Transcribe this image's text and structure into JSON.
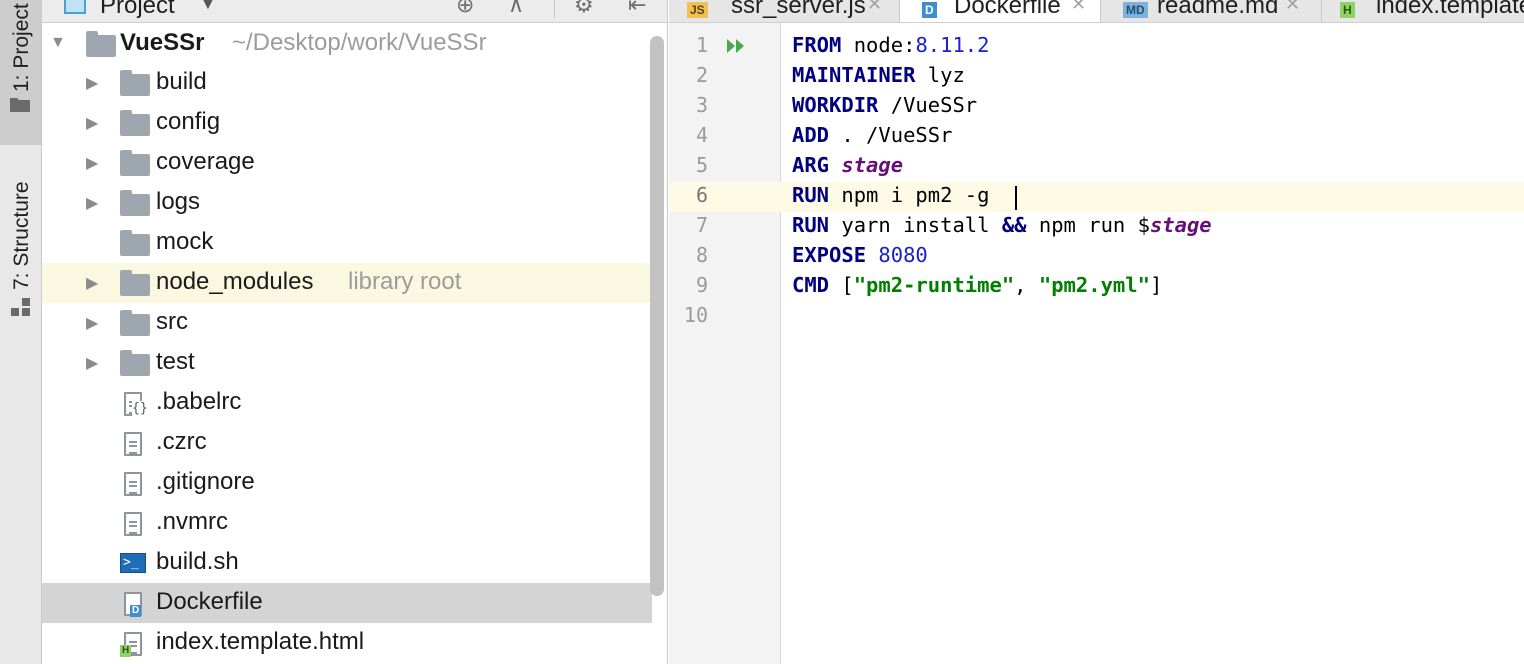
{
  "tool_strip": {
    "project_tab": "1: Project",
    "structure_tab": "7: Structure"
  },
  "project_panel": {
    "title": "Project",
    "root": {
      "name": "VueSSr",
      "path": "~/Desktop/work/VueSSr"
    },
    "items": [
      {
        "label": "build",
        "type": "folder",
        "expandable": true
      },
      {
        "label": "config",
        "type": "folder",
        "expandable": true
      },
      {
        "label": "coverage",
        "type": "folder",
        "expandable": true
      },
      {
        "label": "logs",
        "type": "folder",
        "expandable": true
      },
      {
        "label": "mock",
        "type": "folder",
        "expandable": false
      },
      {
        "label": "node_modules",
        "type": "folder",
        "expandable": true,
        "note": "library root"
      },
      {
        "label": "src",
        "type": "folder",
        "expandable": true
      },
      {
        "label": "test",
        "type": "folder",
        "expandable": true
      },
      {
        "label": ".babelrc",
        "type": "config-file"
      },
      {
        "label": ".czrc",
        "type": "text-file"
      },
      {
        "label": ".gitignore",
        "type": "text-file"
      },
      {
        "label": ".nvmrc",
        "type": "text-file"
      },
      {
        "label": "build.sh",
        "type": "shell-file"
      },
      {
        "label": "Dockerfile",
        "type": "docker-file",
        "selected": true
      },
      {
        "label": "index.template.html",
        "type": "html-file"
      }
    ]
  },
  "tabs": [
    {
      "label": "ssr_server.js",
      "icon": "JS",
      "icon_color": "#f0c050"
    },
    {
      "label": "Dockerfile",
      "icon": "D",
      "icon_color": "#3d8fd0",
      "active": true
    },
    {
      "label": "readme.md",
      "icon": "MD",
      "icon_color": "#7fb2d8"
    },
    {
      "label": "index.template",
      "icon": "H",
      "icon_color": "#8fd267"
    }
  ],
  "editor": {
    "caret_line": 6,
    "line_numbers": [
      "1",
      "2",
      "3",
      "4",
      "5",
      "6",
      "7",
      "8",
      "9",
      "10"
    ],
    "lines": [
      {
        "parts": [
          {
            "t": "FROM",
            "c": "kw"
          },
          {
            "t": " node:",
            "c": ""
          },
          {
            "t": "8.11.2",
            "c": "num"
          }
        ]
      },
      {
        "parts": [
          {
            "t": "MAINTAINER",
            "c": "kw"
          },
          {
            "t": " lyz",
            "c": ""
          }
        ]
      },
      {
        "parts": [
          {
            "t": "WORKDIR",
            "c": "kw"
          },
          {
            "t": " /VueSSr",
            "c": ""
          }
        ]
      },
      {
        "parts": [
          {
            "t": "ADD",
            "c": "kw"
          },
          {
            "t": " . /VueSSr",
            "c": ""
          }
        ]
      },
      {
        "parts": [
          {
            "t": "ARG",
            "c": "kw"
          },
          {
            "t": " ",
            "c": ""
          },
          {
            "t": "stage",
            "c": "var"
          }
        ]
      },
      {
        "parts": [
          {
            "t": "RUN",
            "c": "kw"
          },
          {
            "t": " npm i pm2 -g",
            "c": ""
          }
        ]
      },
      {
        "parts": [
          {
            "t": "RUN",
            "c": "kw"
          },
          {
            "t": " yarn install ",
            "c": ""
          },
          {
            "t": "&&",
            "c": "kw"
          },
          {
            "t": " npm run $",
            "c": ""
          },
          {
            "t": "stage",
            "c": "var"
          }
        ]
      },
      {
        "parts": [
          {
            "t": "EXPOSE",
            "c": "kw"
          },
          {
            "t": " ",
            "c": ""
          },
          {
            "t": "8080",
            "c": "num"
          }
        ]
      },
      {
        "parts": [
          {
            "t": "CMD",
            "c": "kw"
          },
          {
            "t": " [",
            "c": ""
          },
          {
            "t": "\"pm2-runtime\"",
            "c": "str"
          },
          {
            "t": ", ",
            "c": ""
          },
          {
            "t": "\"pm2.yml\"",
            "c": "str"
          },
          {
            "t": "]",
            "c": ""
          }
        ]
      },
      {
        "parts": []
      }
    ]
  },
  "colors": {
    "keyword": "#000080",
    "number": "#1a21c8",
    "variable": "#660e7a",
    "string": "#008000",
    "caret_line_bg": "#fdfae5",
    "selected_row_bg": "#d4d4d4",
    "library_row_bg": "#fbf8e2"
  }
}
